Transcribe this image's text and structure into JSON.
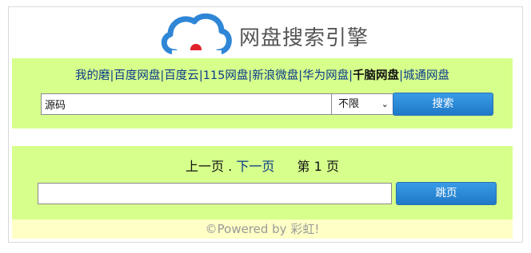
{
  "header": {
    "site_title": "网盘搜索引擎"
  },
  "nav": {
    "items": [
      {
        "label": "我的磨",
        "active": false
      },
      {
        "label": "百度网盘",
        "active": false
      },
      {
        "label": "百度云",
        "active": false
      },
      {
        "label": "115网盘",
        "active": false
      },
      {
        "label": "新浪微盘",
        "active": false
      },
      {
        "label": "华为网盘",
        "active": false
      },
      {
        "label": "千脑网盘",
        "active": true
      },
      {
        "label": "城通网盘",
        "active": false
      }
    ],
    "separator": "|"
  },
  "search": {
    "query": "源码",
    "filter_selected": "不限",
    "button_label": "搜索"
  },
  "pager": {
    "prev_label": "上一页",
    "dot": ".",
    "next_label": "下一页",
    "page_prefix": "第",
    "page_number": "1",
    "page_suffix": "页",
    "jump_value": "",
    "jump_button_label": "跳页"
  },
  "footer": {
    "text": "©Powered by 彩虹!"
  },
  "colors": {
    "panel_bg": "#d6ff8c",
    "footer_bg": "#ffffc6",
    "link": "#0b3a8a",
    "button": "#2a87d6",
    "logo_blue": "#2f86d6",
    "logo_red": "#e0202a"
  },
  "icons": {
    "logo": "cloud-icon",
    "select_arrow": "chevron-down-icon"
  }
}
